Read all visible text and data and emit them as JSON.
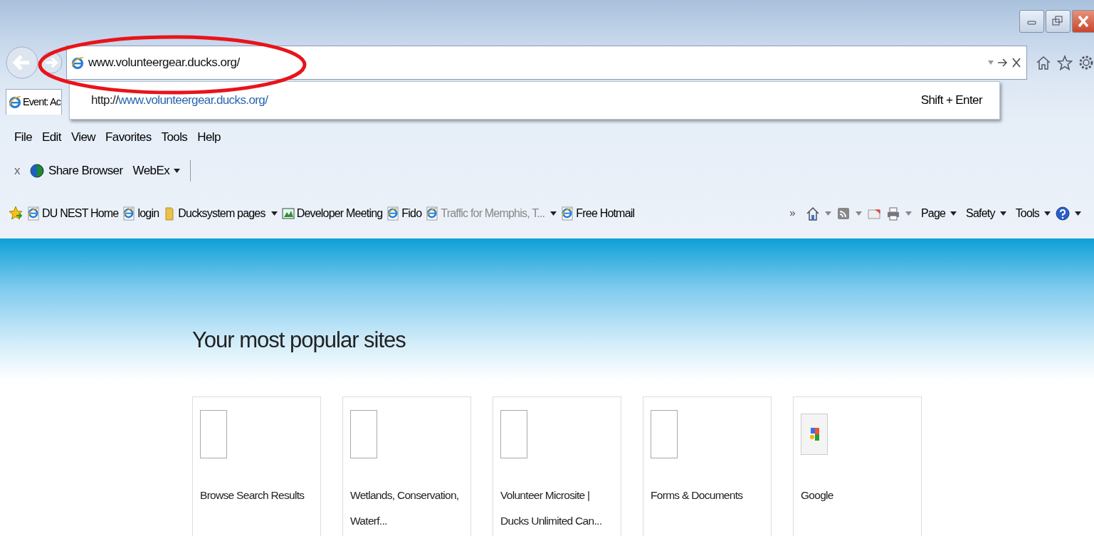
{
  "window": {
    "controls": [
      {
        "kind": "minimize"
      },
      {
        "kind": "restore"
      },
      {
        "kind": "close"
      }
    ]
  },
  "address_bar": {
    "value": "www.volunteergear.ducks.org/",
    "highlighted": true
  },
  "toolbar_icons": [
    {
      "kind": "home"
    },
    {
      "kind": "favorites"
    },
    {
      "kind": "settings"
    }
  ],
  "tabs": [
    {
      "label": "Event: Ac",
      "selected": true
    }
  ],
  "suggestion": {
    "url_prefix": "http://",
    "url_rest": "www.volunteergear.ducks.org/",
    "hint": "Shift + Enter"
  },
  "menu_bar": [
    "File",
    "Edit",
    "View",
    "Favorites",
    "Tools",
    "Help"
  ],
  "webex_bar": {
    "close": "x",
    "label": "Share Browser",
    "menu": "WebEx"
  },
  "favorites_bar": [
    {
      "label": "DU NEST Home",
      "kind": "page",
      "menu": false,
      "dimmed": false
    },
    {
      "label": "login",
      "kind": "page",
      "menu": false,
      "dimmed": false
    },
    {
      "label": "Ducksystem pages",
      "kind": "folder",
      "menu": true,
      "dimmed": false
    },
    {
      "label": "Developer Meeting",
      "kind": "app",
      "menu": false,
      "dimmed": false
    },
    {
      "label": "Fido",
      "kind": "page",
      "menu": false,
      "dimmed": false
    },
    {
      "label": "Traffic for Memphis, T...",
      "kind": "page",
      "menu": true,
      "dimmed": true
    },
    {
      "label": "Free Hotmail",
      "kind": "page",
      "menu": false,
      "dimmed": false
    }
  ],
  "command_bar": {
    "chevron": "»",
    "buttons": [
      {
        "kind": "home",
        "menu": true
      },
      {
        "kind": "feed",
        "menu": true
      },
      {
        "kind": "mail",
        "menu": false
      },
      {
        "kind": "print",
        "menu": true
      }
    ],
    "menus": [
      {
        "label": "Page"
      },
      {
        "label": "Safety"
      },
      {
        "label": "Tools"
      }
    ],
    "help": {
      "menu": true
    }
  },
  "content": {
    "heading": "Your most popular sites",
    "tiles": [
      {
        "label": "Browse Search Results",
        "kind": "blank"
      },
      {
        "label": "Wetlands, Conservation, Waterf...",
        "kind": "blank"
      },
      {
        "label": "Volunteer Microsite | Ducks Unlimited Can...",
        "kind": "blank"
      },
      {
        "label": "Forms & Documents",
        "kind": "blank"
      },
      {
        "label": "Google",
        "kind": "google"
      }
    ]
  }
}
